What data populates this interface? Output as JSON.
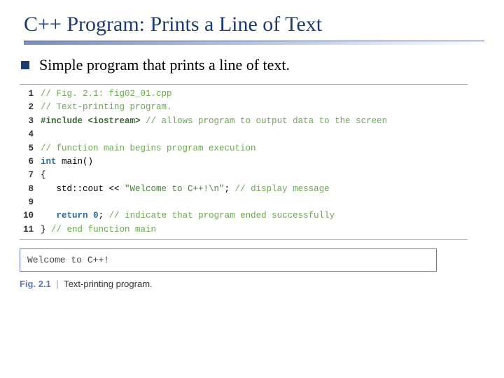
{
  "title": "C++ Program: Prints a Line of Text",
  "bullet": "Simple program that prints a line of text.",
  "code_lines": [
    {
      "n": "1",
      "segs": [
        {
          "cls": "c-comment",
          "t": "// Fig. 2.1: fig02_01.cpp"
        }
      ]
    },
    {
      "n": "2",
      "segs": [
        {
          "cls": "c-comment",
          "t": "// Text-printing program."
        }
      ]
    },
    {
      "n": "3",
      "segs": [
        {
          "cls": "c-pre",
          "t": "#include <iostream>"
        },
        {
          "cls": "c-comment",
          "t": " // allows program to output data to the screen"
        }
      ]
    },
    {
      "n": "4",
      "segs": [
        {
          "cls": "",
          "t": ""
        }
      ]
    },
    {
      "n": "5",
      "segs": [
        {
          "cls": "c-comment",
          "t": "// function main begins program execution"
        }
      ]
    },
    {
      "n": "6",
      "segs": [
        {
          "cls": "c-keyword",
          "t": "int"
        },
        {
          "cls": "",
          "t": " main()"
        }
      ]
    },
    {
      "n": "7",
      "segs": [
        {
          "cls": "",
          "t": "{"
        }
      ]
    },
    {
      "n": "8",
      "segs": [
        {
          "cls": "",
          "t": "   std::cout << "
        },
        {
          "cls": "c-string",
          "t": "\"Welcome to C++!\\n\""
        },
        {
          "cls": "",
          "t": "; "
        },
        {
          "cls": "c-comment",
          "t": "// display message"
        }
      ]
    },
    {
      "n": "9",
      "segs": [
        {
          "cls": "",
          "t": ""
        }
      ]
    },
    {
      "n": "10",
      "segs": [
        {
          "cls": "",
          "t": "   "
        },
        {
          "cls": "c-keyword",
          "t": "return"
        },
        {
          "cls": "",
          "t": " "
        },
        {
          "cls": "c-keyword",
          "t": "0"
        },
        {
          "cls": "",
          "t": "; "
        },
        {
          "cls": "c-comment",
          "t": "// indicate that program ended successfully"
        }
      ]
    },
    {
      "n": "11",
      "segs": [
        {
          "cls": "",
          "t": "} "
        },
        {
          "cls": "c-comment",
          "t": "// end function main"
        }
      ]
    }
  ],
  "output": "Welcome to C++!",
  "caption": {
    "label": "Fig. 2.1",
    "sep": "|",
    "text": "Text-printing program."
  }
}
